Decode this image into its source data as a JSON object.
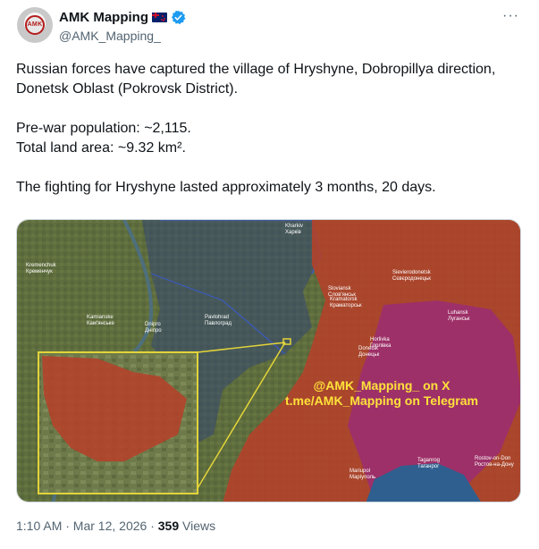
{
  "author": {
    "display_name": "AMK Mapping",
    "handle": "@AMK_Mapping_",
    "avatar_text": "AMK",
    "flag_icon": "new-zealand-flag-icon",
    "verified_icon": "verified-badge-icon"
  },
  "more_label": "···",
  "tweet": {
    "text": "Russian forces have captured the village of Hryshyne, Dobropillya direction, Donetsk Oblast (Pokrovsk District).\n\nPre-war population: ~2,115.\nTotal land area: ~9.32 km².\n\nThe fighting for Hryshyne lasted approximately 3 months, 20 days."
  },
  "map": {
    "watermark_line1": "@AMK_Mapping_ on X",
    "watermark_line2": "t.me/AMK_Mapping on Telegram",
    "colors": {
      "occupied": "#b5412a",
      "pre2022": "#9c2f6e",
      "contested_blue": "#2b3f7e",
      "land": "#5d6b3c",
      "sea": "#2f5f8f",
      "inset_border": "#e2d43a",
      "watermark": "#ffe23a"
    },
    "place_labels": [
      {
        "text": "Kamianske\nКам'янське"
      },
      {
        "text": "Dnipro\nДніпро"
      },
      {
        "text": "Pavlohrad\nПавлоград"
      },
      {
        "text": "Sloviansk\nСлов'янськ"
      },
      {
        "text": "Kramatorsk\nКраматорськ"
      },
      {
        "text": "Donetsk\nДонецьк"
      },
      {
        "text": "Luhansk\nЛуганськ"
      },
      {
        "text": "Horlivka\nГорлівка"
      },
      {
        "text": "Mariupol\nМаріуполь"
      },
      {
        "text": "Taganrog\nТаганрог"
      },
      {
        "text": "Rostov-on-Don\nРостов-на-Дону"
      },
      {
        "text": "Sievierodonetsk\nСєвєродонецьк"
      },
      {
        "text": "Kremenchuk\nКременчук"
      },
      {
        "text": "Kharkiv\nХарків"
      }
    ]
  },
  "meta": {
    "time": "1:10 AM · Mar 12, 2026 · ",
    "views_count": "359",
    "views_label": " Views"
  }
}
